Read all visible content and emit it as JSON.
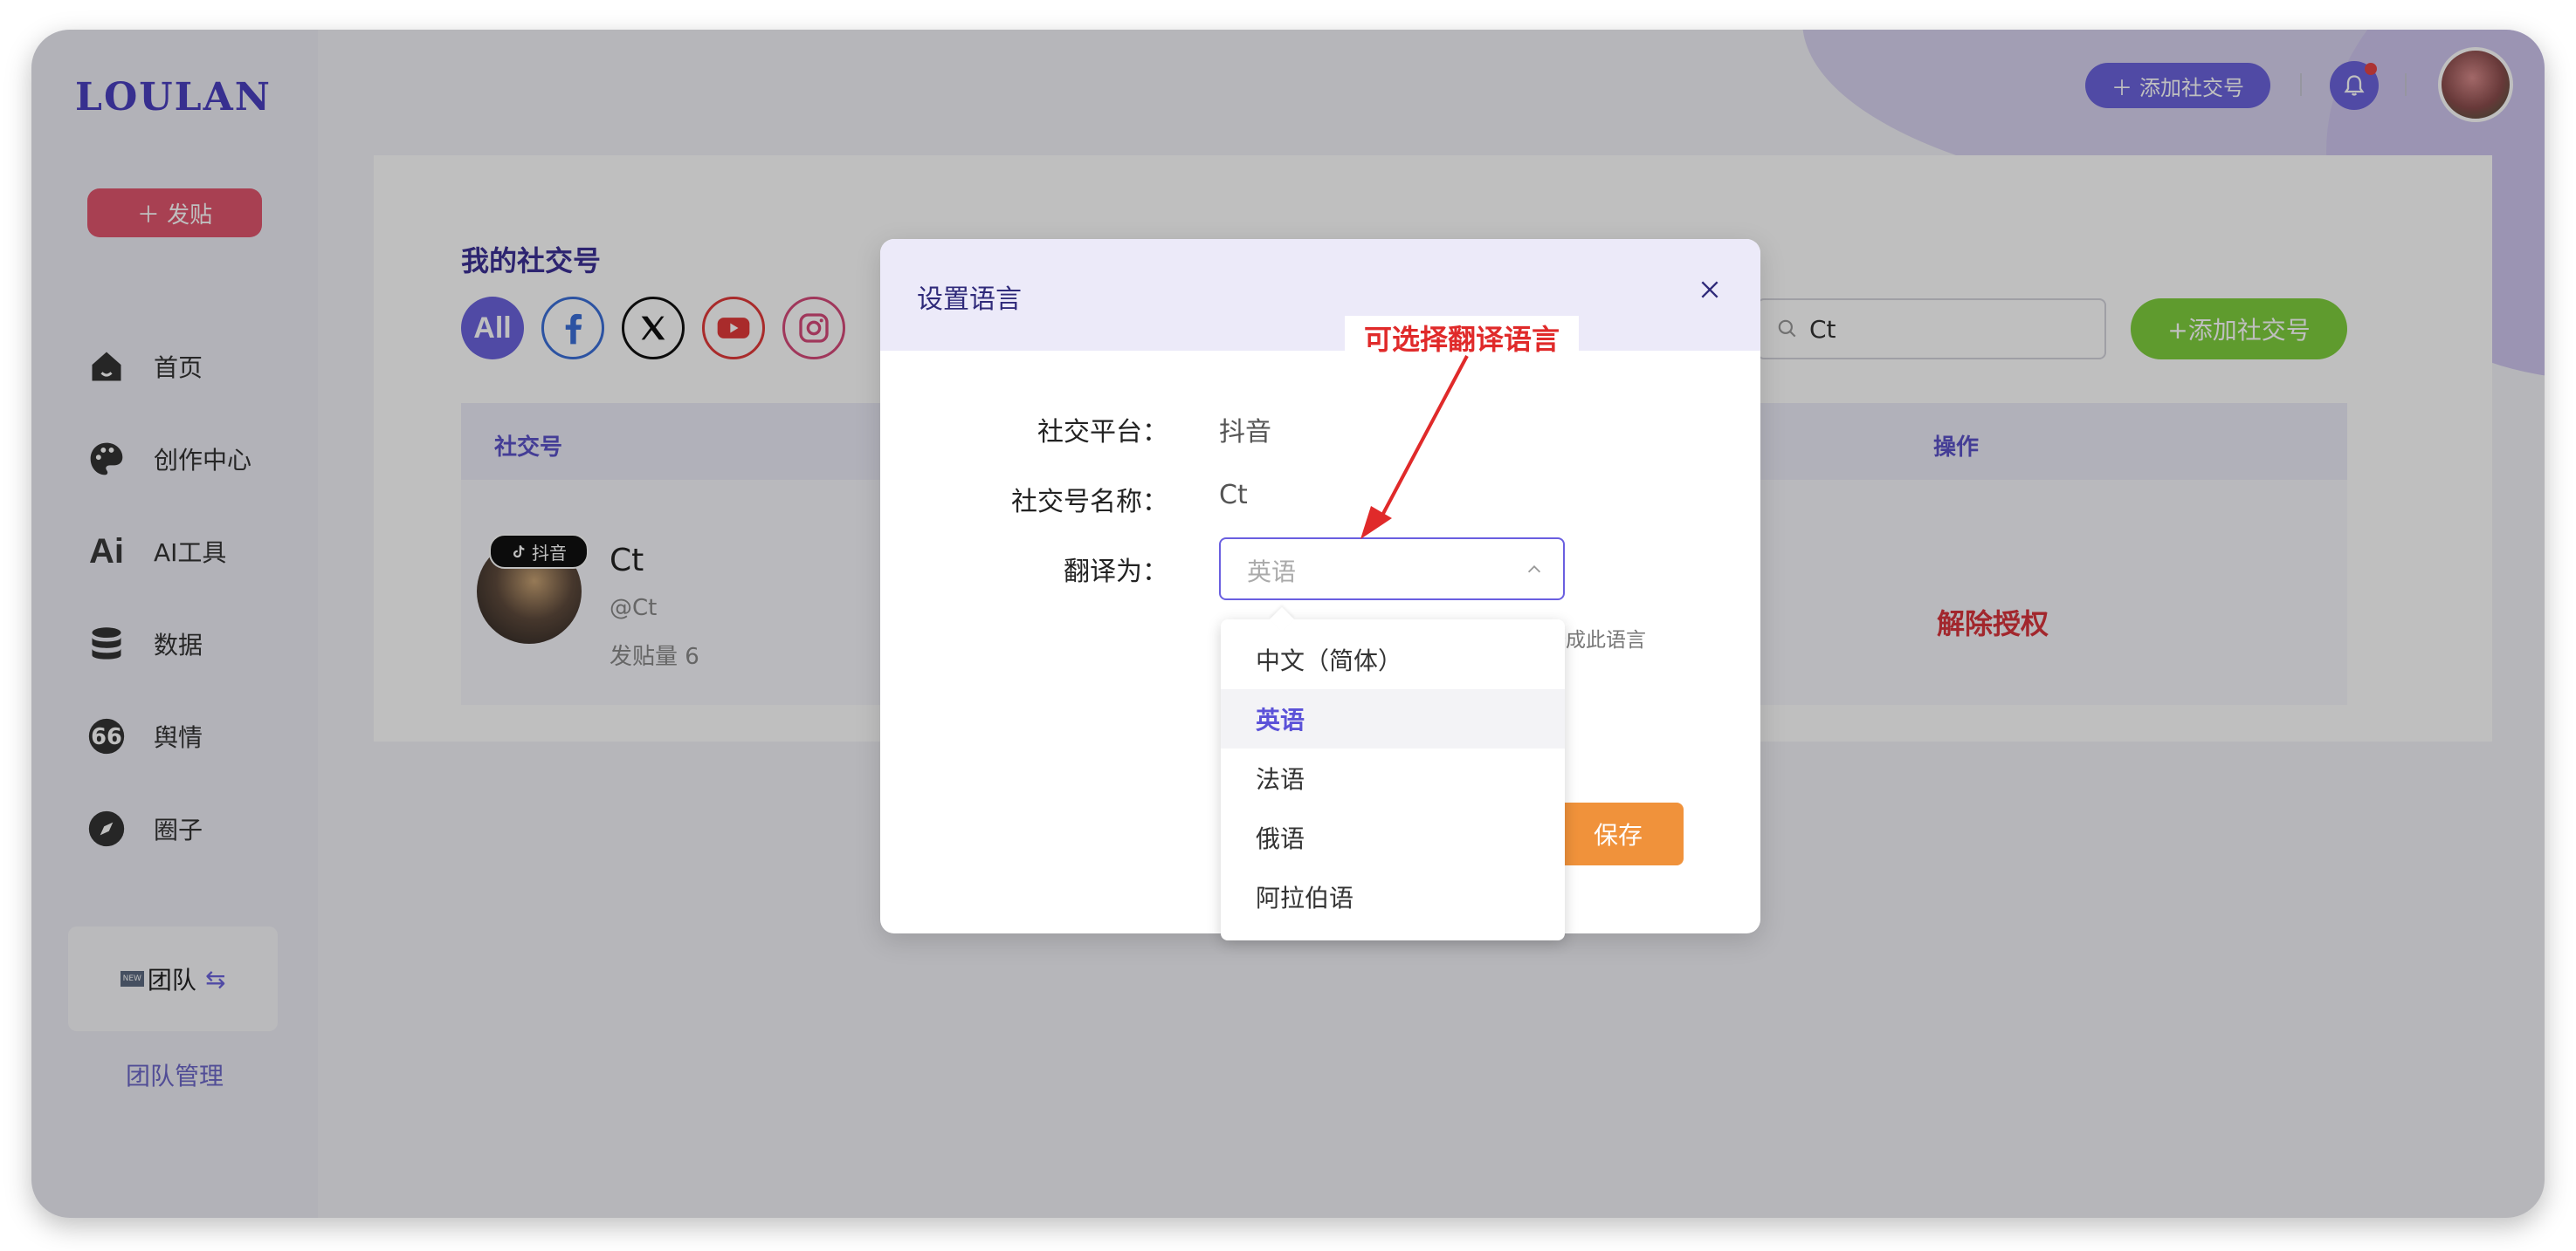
{
  "app": {
    "logo": "LOULAN"
  },
  "sidebar": {
    "post_button": "＋ 发贴",
    "items": [
      {
        "label": "首页",
        "icon": "home-icon"
      },
      {
        "label": "创作中心",
        "icon": "palette-icon"
      },
      {
        "label": "AI工具",
        "icon": "ai-icon"
      },
      {
        "label": "数据",
        "icon": "database-icon"
      },
      {
        "label": "舆情",
        "icon": "quote-icon"
      },
      {
        "label": "圈子",
        "icon": "compass-icon"
      }
    ],
    "team": {
      "badge": "NEW",
      "label": "团队",
      "switch_icon": "⇆"
    },
    "team_manage": "团队管理"
  },
  "header": {
    "add_account": "添加社交号",
    "plus": "＋"
  },
  "main": {
    "title": "我的社交号",
    "platforms": [
      {
        "name": "All",
        "icon": "all-icon"
      },
      {
        "name": "Facebook",
        "icon": "facebook-icon"
      },
      {
        "name": "X",
        "icon": "x-icon"
      },
      {
        "name": "YouTube",
        "icon": "youtube-icon"
      },
      {
        "name": "Instagram",
        "icon": "instagram-icon"
      }
    ],
    "search": {
      "value": "Ct"
    },
    "add_button": "+添加社交号",
    "table": {
      "columns": [
        "社交号",
        "操作"
      ],
      "rows": [
        {
          "name": "Ct",
          "handle": "@Ct",
          "posts": "发贴量 6",
          "platform_badge": "抖音",
          "action": "解除授权"
        }
      ]
    }
  },
  "dialog": {
    "title": "设置语言",
    "fields": {
      "platform_label": "社交平台：",
      "platform_value": "抖音",
      "name_label": "社交号名称：",
      "name_value": "Ct",
      "translate_label": "翻译为："
    },
    "select": {
      "placeholder": "英语"
    },
    "hint_fragment": "译成此语言",
    "save": "保存"
  },
  "dropdown": {
    "options": [
      "中文（简体）",
      "英语",
      "法语",
      "俄语",
      "阿拉伯语"
    ],
    "selected": "英语"
  },
  "annotation": {
    "text": "可选择翻译语言"
  },
  "colors": {
    "accent": "#6b63dc",
    "green": "#7fcf3e",
    "danger": "#d9343c",
    "save": "#f0923b",
    "annotation": "#e02a2a"
  }
}
